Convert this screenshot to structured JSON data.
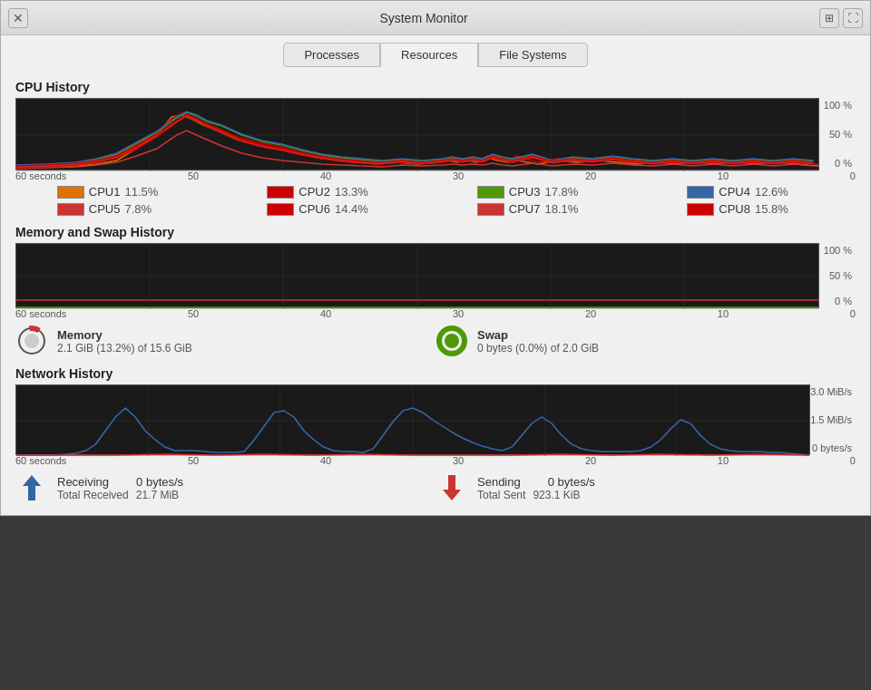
{
  "window": {
    "title": "System Monitor",
    "close_icon": "✕",
    "monitor_icon": "📊",
    "expand_icon": "⛶"
  },
  "tabs": [
    {
      "label": "Processes",
      "active": false
    },
    {
      "label": "Resources",
      "active": true
    },
    {
      "label": "File Systems",
      "active": false
    }
  ],
  "cpu": {
    "section_title": "CPU History",
    "y_labels": [
      "100 %",
      "50 %",
      "0 %"
    ],
    "x_labels": [
      "60 seconds",
      "50",
      "40",
      "30",
      "20",
      "10",
      "0"
    ],
    "legend": [
      {
        "id": "CPU1",
        "pct": "11.5%",
        "color": "#e07000"
      },
      {
        "id": "CPU2",
        "pct": "13.3%",
        "color": "#cc0000"
      },
      {
        "id": "CPU3",
        "pct": "17.8%",
        "color": "#4e9a06"
      },
      {
        "id": "CPU4",
        "pct": "12.6%",
        "color": "#3465a4"
      },
      {
        "id": "CPU5",
        "pct": "7.8%",
        "color": "#cc3333"
      },
      {
        "id": "CPU6",
        "pct": "14.4%",
        "color": "#cc0000"
      },
      {
        "id": "CPU7",
        "pct": "18.1%",
        "color": "#cc3333"
      },
      {
        "id": "CPU8",
        "pct": "15.8%",
        "color": "#cc0000"
      }
    ]
  },
  "memory": {
    "section_title": "Memory and Swap History",
    "y_labels": [
      "100 %",
      "50 %",
      "0 %"
    ],
    "x_labels": [
      "60 seconds",
      "50",
      "40",
      "30",
      "20",
      "10",
      "0"
    ],
    "memory_label": "Memory",
    "memory_detail": "2.1 GiB (13.2%) of 15.6 GiB",
    "swap_label": "Swap",
    "swap_detail": "0 bytes (0.0%) of 2.0 GiB",
    "memory_color": "#cc3333",
    "swap_color": "#4e9a06"
  },
  "network": {
    "section_title": "Network History",
    "y_labels": [
      "3.0 MiB/s",
      "1.5 MiB/s",
      "0 bytes/s"
    ],
    "x_labels": [
      "60 seconds",
      "50",
      "40",
      "30",
      "20",
      "10",
      "0"
    ],
    "receiving_label": "Receiving",
    "receiving_val": "0 bytes/s",
    "total_received_label": "Total Received",
    "total_received_val": "21.7 MiB",
    "sending_label": "Sending",
    "sending_val": "0 bytes/s",
    "total_sent_label": "Total Sent",
    "total_sent_val": "923.1 KiB"
  }
}
